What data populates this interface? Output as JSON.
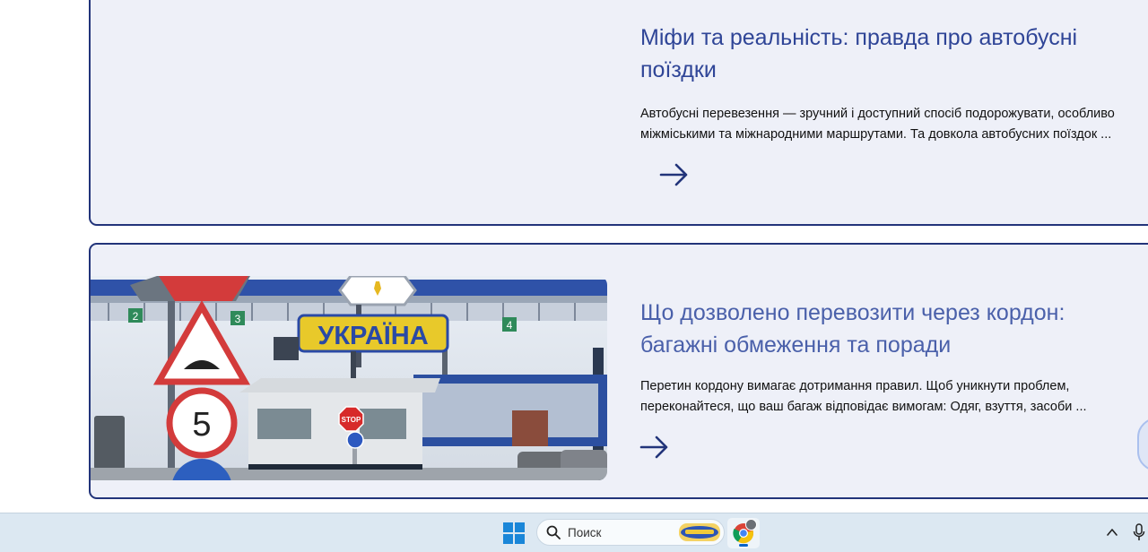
{
  "articles": [
    {
      "title": "Міфи та реальність: правда про автобусні поїздки",
      "excerpt": "Автобусні перевезення — зручний і доступний спосіб подорожувати, особливо міжміськими та міжнародними маршрутами. Та довкола автобусних поїздок ...",
      "more_icon": "arrow-right-icon"
    },
    {
      "title": "Що дозволено перевозити через кордон: багажні обмеження та поради",
      "excerpt": "Перетин кордону вимагає дотримання правил. Щоб уникнути проблем, переконайтеся, що ваш багаж відповідає вимогам: Одяг, взуття, засоби ...",
      "image_sign_text": "УКРАЇНА",
      "image_lane_numbers": [
        "2",
        "3",
        "4"
      ],
      "image_speed_limit": "5",
      "image_stop_text": "STOP",
      "more_icon": "arrow-right-icon"
    }
  ],
  "taskbar": {
    "search_placeholder": "Поиск",
    "colors": {
      "background": "#dce8f2",
      "accent": "#0a64c8"
    },
    "icons": [
      "windows-start-icon",
      "search-icon",
      "chrome-icon",
      "chevron-up-icon",
      "microphone-icon"
    ]
  },
  "colors": {
    "primary": "#22347a",
    "title": "#2f4597",
    "card_background": "#eef0f8"
  }
}
